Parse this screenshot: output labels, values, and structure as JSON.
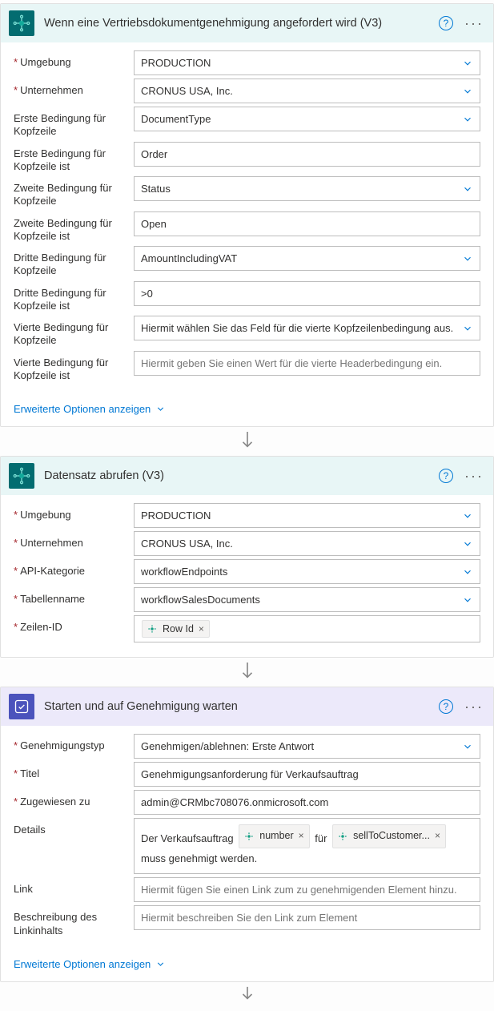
{
  "cards": [
    {
      "id": "trigger",
      "title": "Wenn eine Vertriebsdokumentgenehmigung angefordert wird (V3)",
      "adv": "Erweiterte Optionen anzeigen"
    },
    {
      "id": "get",
      "title": "Datensatz abrufen (V3)"
    },
    {
      "id": "approval",
      "title": "Starten und auf Genehmigung warten",
      "adv": "Erweiterte Optionen anzeigen"
    }
  ],
  "trigger": {
    "umgebung_label": "Umgebung",
    "umgebung_value": "PRODUCTION",
    "unternehmen_label": "Unternehmen",
    "unternehmen_value": "CRONUS USA, Inc.",
    "c1f_label": "Erste Bedingung für Kopfzeile",
    "c1f_value": "DocumentType",
    "c1v_label": "Erste Bedingung für Kopfzeile ist",
    "c1v_value": "Order",
    "c2f_label": "Zweite Bedingung für Kopfzeile",
    "c2f_value": "Status",
    "c2v_label": "Zweite Bedingung für Kopfzeile ist",
    "c2v_value": "Open",
    "c3f_label": "Dritte Bedingung für Kopfzeile",
    "c3f_value": "AmountIncludingVAT",
    "c3v_label": "Dritte Bedingung für Kopfzeile ist",
    "c3v_value": ">0",
    "c4f_label": "Vierte Bedingung für Kopfzeile",
    "c4f_placeholder": "Hiermit wählen Sie das Feld für die vierte Kopfzeilenbedingung aus.",
    "c4v_label": "Vierte Bedingung für Kopfzeile ist",
    "c4v_placeholder": "Hiermit geben Sie einen Wert für die vierte Headerbedingung ein."
  },
  "get": {
    "umgebung_label": "Umgebung",
    "umgebung_value": "PRODUCTION",
    "unternehmen_label": "Unternehmen",
    "unternehmen_value": "CRONUS USA, Inc.",
    "api_label": "API-Kategorie",
    "api_value": "workflowEndpoints",
    "table_label": "Tabellenname",
    "table_value": "workflowSalesDocuments",
    "rowid_label": "Zeilen-ID",
    "rowid_token": "Row Id"
  },
  "approval": {
    "type_label": "Genehmigungstyp",
    "type_value": "Genehmigen/ablehnen: Erste Antwort",
    "title_label": "Titel",
    "title_value": "Genehmigungsanforderung für Verkaufsauftrag",
    "assigned_label": "Zugewiesen zu",
    "assigned_value": "admin@CRMbc708076.onmicrosoft.com",
    "details_label": "Details",
    "details_t1": "Der Verkaufsauftrag",
    "details_tok1": "number",
    "details_t2": "für",
    "details_tok2": "sellToCustomer...",
    "details_t3": "muss genehmigt werden.",
    "link_label": "Link",
    "link_placeholder": "Hiermit fügen Sie einen Link zum zu genehmigenden Element hinzu.",
    "linkdesc_label": "Beschreibung des Linkinhalts",
    "linkdesc_placeholder": "Hiermit beschreiben Sie den Link zum Element"
  }
}
